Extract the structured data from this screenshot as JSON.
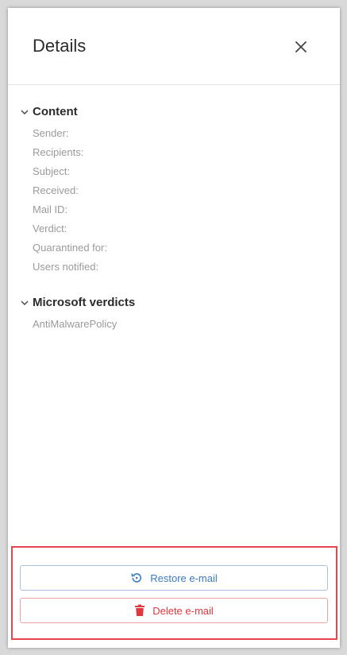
{
  "panel": {
    "title": "Details",
    "close_icon": "close-icon"
  },
  "sections": {
    "content": {
      "title": "Content",
      "fields": [
        "Sender:",
        "Recipients:",
        "Subject:",
        "Received:",
        "Mail ID:",
        "Verdict:",
        "Quarantined for:",
        "Users notified:"
      ]
    },
    "microsoft_verdicts": {
      "title": "Microsoft verdicts",
      "fields": [
        "AntiMalwarePolicy"
      ]
    }
  },
  "actions": {
    "restore_label": "Restore e-mail",
    "restore_icon": "restore-icon",
    "delete_label": "Delete e-mail",
    "delete_icon": "trash-icon"
  },
  "colors": {
    "restore": "#3a7bbf",
    "delete": "#e0383f",
    "highlight_border": "#e5454c",
    "field_label": "#9a9a9a"
  }
}
